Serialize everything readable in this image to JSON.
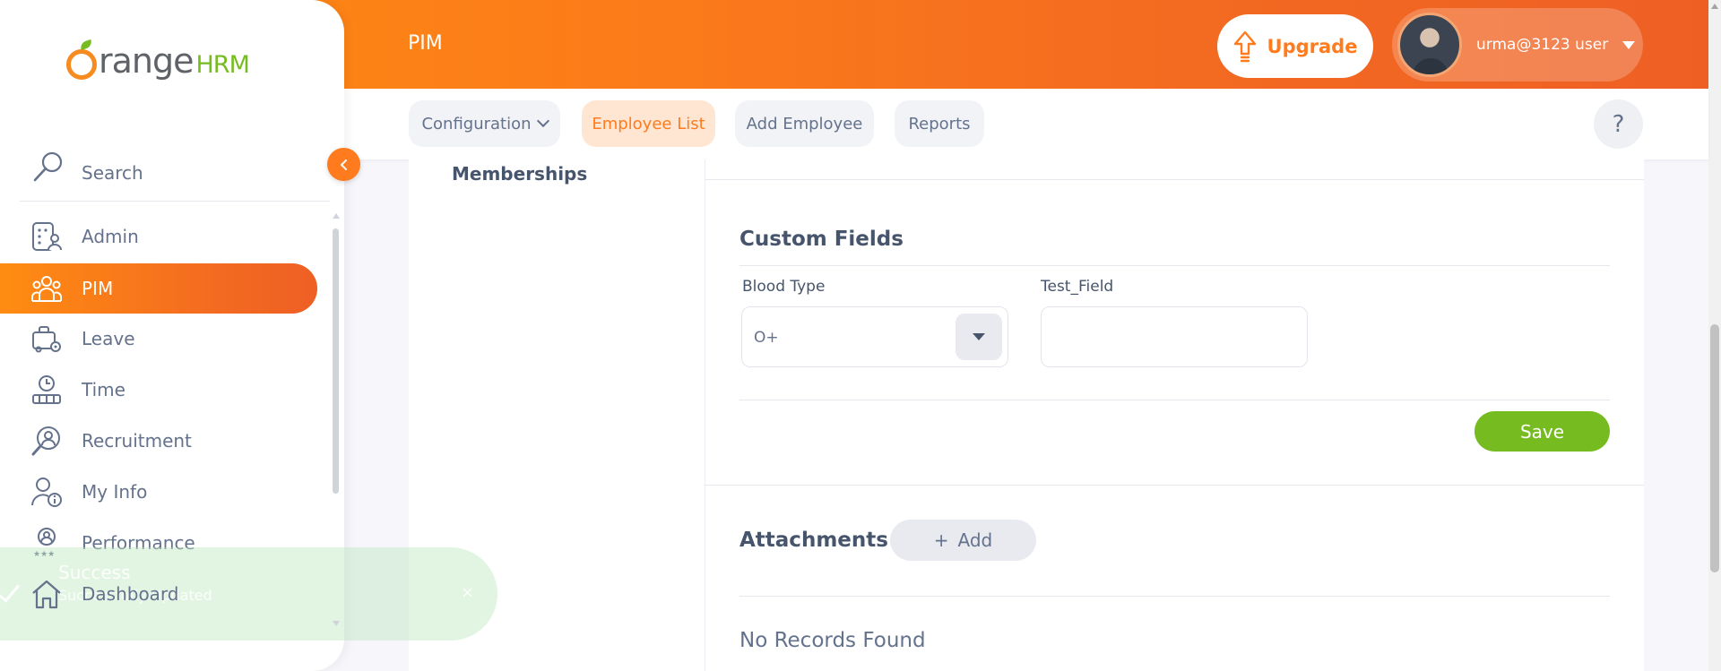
{
  "header": {
    "page_title": "PIM",
    "upgrade_label": "Upgrade",
    "user_name": "urma@3123 user"
  },
  "subnav": {
    "tabs": [
      {
        "label": "Configuration",
        "has_dropdown": true,
        "active": false
      },
      {
        "label": "Employee List",
        "active": true
      },
      {
        "label": "Add Employee",
        "active": false
      },
      {
        "label": "Reports",
        "active": false
      }
    ],
    "help_label": "?"
  },
  "sidebar": {
    "brand": {
      "orange": "range",
      "hrm": "HRM"
    },
    "search_label": "Search",
    "items": [
      {
        "label": "Admin",
        "icon": "admin-icon"
      },
      {
        "label": "PIM",
        "icon": "pim-icon",
        "active": true
      },
      {
        "label": "Leave",
        "icon": "leave-icon"
      },
      {
        "label": "Time",
        "icon": "time-icon"
      },
      {
        "label": "Recruitment",
        "icon": "recruitment-icon"
      },
      {
        "label": "My Info",
        "icon": "my-info-icon"
      },
      {
        "label": "Performance",
        "icon": "performance-icon"
      },
      {
        "label": "Dashboard",
        "icon": "dashboard-icon"
      }
    ]
  },
  "left_panel": {
    "memberships_label": "Memberships"
  },
  "custom_fields": {
    "title": "Custom Fields",
    "blood_type_label": "Blood Type",
    "blood_type_value": "O+",
    "test_field_label": "Test_Field",
    "test_field_value": "",
    "save_label": "Save"
  },
  "attachments": {
    "title": "Attachments",
    "add_label": "Add",
    "empty_text": "No Records Found"
  },
  "toast": {
    "title": "Success",
    "message": "Successfully Updated",
    "close_label": "×"
  },
  "colors": {
    "brand_orange": "#ff7b1d",
    "save_green": "#76bc21"
  }
}
